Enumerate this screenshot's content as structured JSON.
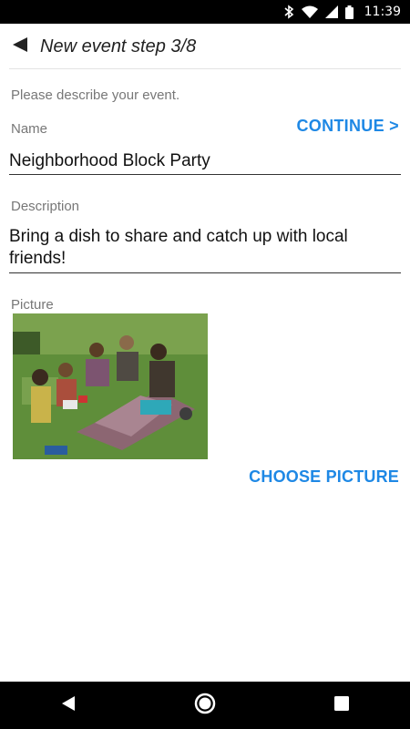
{
  "status_bar": {
    "time": "11:39",
    "icons": [
      "bluetooth-icon",
      "wifi-icon",
      "signal-icon",
      "battery-icon"
    ]
  },
  "app_bar": {
    "title": "New event step 3/8",
    "back_icon": "back-arrow-icon"
  },
  "form": {
    "prompt": "Please describe your event.",
    "continue_label": "CONTINUE >",
    "name_label": "Name",
    "name_value": "Neighborhood Block Party",
    "description_label": "Description",
    "description_value": "Bring a dish to share and catch up with local friends!",
    "picture_label": "Picture",
    "choose_picture_label": "CHOOSE PICTURE"
  },
  "nav_bar": {
    "buttons": [
      "back-triangle-icon",
      "home-circle-icon",
      "recents-square-icon"
    ]
  },
  "colors": {
    "accent": "#1e88e5",
    "label": "#777777",
    "text": "#111111",
    "status_bar": "#000000"
  }
}
